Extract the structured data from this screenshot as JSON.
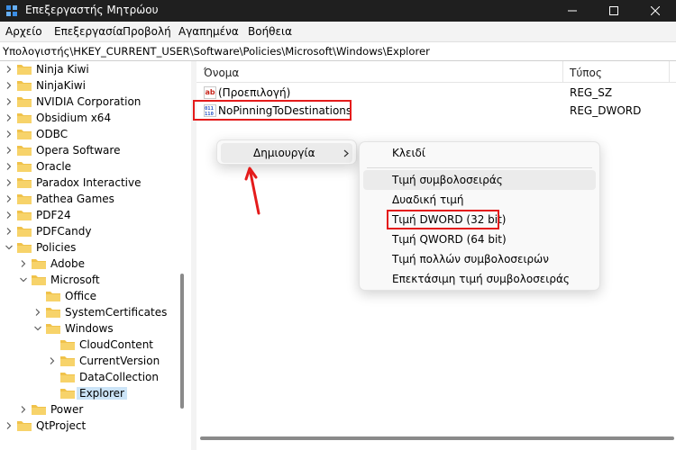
{
  "window": {
    "title": "Επεξεργαστής Μητρώου",
    "icon": "registry-editor-icon"
  },
  "menubar": [
    "Αρχείο",
    "Επεξεργασία",
    "Προβολή",
    "Αγαπημένα",
    "Βοήθεια"
  ],
  "address": "Υπολογιστής\\HKEY_CURRENT_USER\\Software\\Policies\\Microsoft\\Windows\\Explorer",
  "tree": [
    {
      "label": "Ninja Kiwi",
      "expanded": false
    },
    {
      "label": "NinjaKiwi",
      "expanded": false
    },
    {
      "label": "NVIDIA Corporation",
      "expanded": false
    },
    {
      "label": "Obsidium x64",
      "expanded": false
    },
    {
      "label": "ODBC",
      "expanded": false
    },
    {
      "label": "Opera Software",
      "expanded": false
    },
    {
      "label": "Oracle",
      "expanded": false
    },
    {
      "label": "Paradox Interactive",
      "expanded": false
    },
    {
      "label": "Pathea Games",
      "expanded": false
    },
    {
      "label": "PDF24",
      "expanded": false
    },
    {
      "label": "PDFCandy",
      "expanded": false
    },
    {
      "label": "Policies",
      "expanded": true
    },
    {
      "label": "Adobe",
      "expanded": false
    },
    {
      "label": "Microsoft",
      "expanded": true
    },
    {
      "label": "Office",
      "expanded": null
    },
    {
      "label": "SystemCertificates",
      "expanded": false
    },
    {
      "label": "Windows",
      "expanded": true
    },
    {
      "label": "CloudContent",
      "expanded": null
    },
    {
      "label": "CurrentVersion",
      "expanded": false
    },
    {
      "label": "DataCollection",
      "expanded": null
    },
    {
      "label": "Explorer",
      "expanded": null,
      "selected": true
    },
    {
      "label": "Power",
      "expanded": false
    },
    {
      "label": "QtProject",
      "expanded": false
    }
  ],
  "list": {
    "headers": {
      "name": "Όνομα",
      "type": "Τύπος"
    },
    "rows": [
      {
        "name": "(Προεπιλογή)",
        "type": "REG_SZ",
        "icon": "string-value-icon"
      },
      {
        "name": "NoPinningToDestinations",
        "type": "REG_DWORD",
        "icon": "binary-value-icon"
      }
    ]
  },
  "context_menu": {
    "new_label": "Δημιουργία",
    "submenu": [
      "Κλειδί",
      "Τιμή συμβολοσειράς",
      "Δυαδική τιμή",
      "Τιμή DWORD (32 bit)",
      "Τιμή QWORD (64 bit)",
      "Τιμή πολλών συμβολοσειρών",
      "Επεκτάσιμη τιμή συμβολοσειράς"
    ]
  },
  "colors": {
    "folder": "#f0c24a",
    "highlight_box": "#e41b1b",
    "selection": "#cce4f7"
  }
}
